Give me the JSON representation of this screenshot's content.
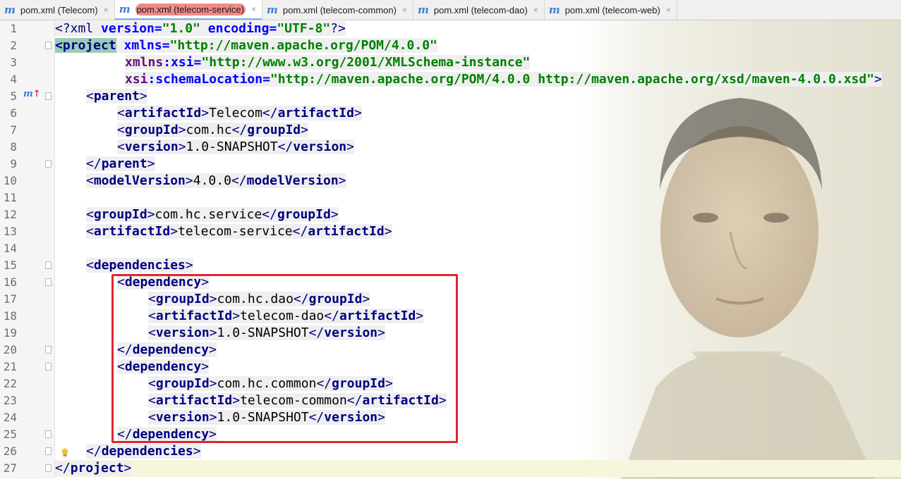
{
  "tabs": [
    {
      "label": "pom.xml (Telecom)",
      "active": false
    },
    {
      "label": "pom.xml (telecom-service)",
      "active": true
    },
    {
      "label": "pom.xml (telecom-common)",
      "active": false
    },
    {
      "label": "pom.xml (telecom-dao)",
      "active": false
    },
    {
      "label": "pom.xml (telecom-web)",
      "active": false
    }
  ],
  "tab_icon": "m",
  "tab_close_glyph": "×",
  "line_numbers": [
    "1",
    "2",
    "3",
    "4",
    "5",
    "6",
    "7",
    "8",
    "9",
    "10",
    "11",
    "12",
    "13",
    "14",
    "15",
    "16",
    "17",
    "18",
    "19",
    "20",
    "21",
    "22",
    "23",
    "24",
    "25",
    "26",
    "27"
  ],
  "gutter_markers": {
    "line5": "m"
  },
  "code": {
    "l1": {
      "open": "<?xml ",
      "version_attr": "version",
      "eq1": "=",
      "version_val": "\"1.0\"",
      "sp": " ",
      "enc_attr": "encoding",
      "eq2": "=",
      "enc_val": "\"UTF-8\"",
      "close": "?>"
    },
    "l2": {
      "tag": "<project",
      "sp": " ",
      "attr": "xmlns",
      "eq": "=",
      "val": "\"http://maven.apache.org/POM/4.0.0\""
    },
    "l3": {
      "ns": "xmlns",
      "colon": ":",
      "attr": "xsi",
      "eq": "=",
      "val": "\"http://www.w3.org/2001/XMLSchema-instance\""
    },
    "l4": {
      "ns": "xsi",
      "colon": ":",
      "attr": "schemaLocation",
      "eq": "=",
      "val": "\"http://maven.apache.org/POM/4.0.0 http://maven.apache.org/xsd/maven-4.0.0.xsd\"",
      "close": ">"
    },
    "l5": {
      "tag": "parent"
    },
    "l6": {
      "tag": "artifactId",
      "value": "Telecom"
    },
    "l7": {
      "tag": "groupId",
      "value": "com.hc"
    },
    "l8": {
      "tag": "version",
      "value": "1.0-SNAPSHOT"
    },
    "l9": {
      "tag": "parent"
    },
    "l10": {
      "tag": "modelVersion",
      "value": "4.0.0"
    },
    "l12": {
      "tag": "groupId",
      "value": "com.hc.service"
    },
    "l13": {
      "tag": "artifactId",
      "value": "telecom-service"
    },
    "l15": {
      "tag": "dependencies"
    },
    "l16": {
      "tag": "dependency"
    },
    "l17": {
      "tag": "groupId",
      "value": "com.hc.dao"
    },
    "l18": {
      "tag": "artifactId",
      "value": "telecom-dao"
    },
    "l19": {
      "tag": "version",
      "value": "1.0-SNAPSHOT"
    },
    "l20": {
      "tag": "dependency"
    },
    "l21": {
      "tag": "dependency"
    },
    "l22": {
      "tag": "groupId",
      "value": "com.hc.common"
    },
    "l23": {
      "tag": "artifactId",
      "value": "telecom-common"
    },
    "l24": {
      "tag": "version",
      "value": "1.0-SNAPSHOT"
    },
    "l25": {
      "tag": "dependency"
    },
    "l26": {
      "tag": "dependencies"
    },
    "l27": {
      "tag": "project"
    }
  },
  "syntax": {
    "lt": "<",
    "gt": ">",
    "lt_slash": "</"
  },
  "colors": {
    "tag": "#000080",
    "string": "#008000",
    "attribute": "#0000ff",
    "namespace": "#660e7a",
    "highlight_box": "#e0262f",
    "tab_icon": "#3f7fd6"
  }
}
